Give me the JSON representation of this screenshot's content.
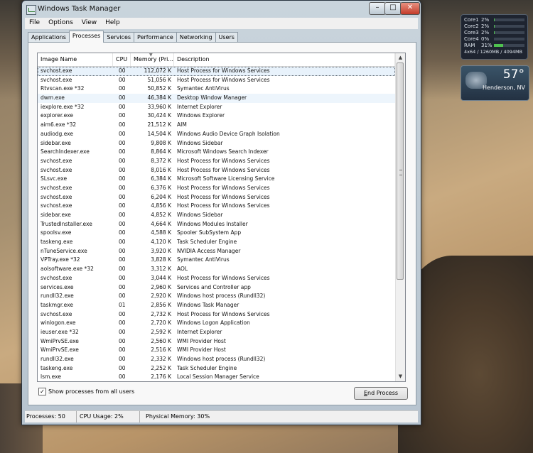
{
  "window": {
    "title": "Windows Task Manager"
  },
  "menu": [
    "File",
    "Options",
    "View",
    "Help"
  ],
  "tabs": [
    "Applications",
    "Processes",
    "Services",
    "Performance",
    "Networking",
    "Users"
  ],
  "active_tab": "Processes",
  "columns": {
    "name": "Image Name",
    "cpu": "CPU",
    "mem": "Memory (Pri...",
    "desc": "Description"
  },
  "processes": [
    [
      "svchost.exe",
      "00",
      "112,072 K",
      "Host Process for Windows Services"
    ],
    [
      "svchost.exe",
      "00",
      "51,056 K",
      "Host Process for Windows Services"
    ],
    [
      "Rtvscan.exe *32",
      "00",
      "50,852 K",
      "Symantec AntiVirus"
    ],
    [
      "dwm.exe",
      "00",
      "46,384 K",
      "Desktop Window Manager"
    ],
    [
      "iexplore.exe *32",
      "00",
      "33,960 K",
      "Internet Explorer"
    ],
    [
      "explorer.exe",
      "00",
      "30,424 K",
      "Windows Explorer"
    ],
    [
      "aim6.exe *32",
      "00",
      "21,512 K",
      "AIM"
    ],
    [
      "audiodg.exe",
      "00",
      "14,504 K",
      "Windows Audio Device Graph Isolation"
    ],
    [
      "sidebar.exe",
      "00",
      "9,808 K",
      "Windows Sidebar"
    ],
    [
      "SearchIndexer.exe",
      "00",
      "8,864 K",
      "Microsoft Windows Search Indexer"
    ],
    [
      "svchost.exe",
      "00",
      "8,372 K",
      "Host Process for Windows Services"
    ],
    [
      "svchost.exe",
      "00",
      "8,016 K",
      "Host Process for Windows Services"
    ],
    [
      "SLsvc.exe",
      "00",
      "6,384 K",
      "Microsoft Software Licensing Service"
    ],
    [
      "svchost.exe",
      "00",
      "6,376 K",
      "Host Process for Windows Services"
    ],
    [
      "svchost.exe",
      "00",
      "6,204 K",
      "Host Process for Windows Services"
    ],
    [
      "svchost.exe",
      "00",
      "4,856 K",
      "Host Process for Windows Services"
    ],
    [
      "sidebar.exe",
      "00",
      "4,852 K",
      "Windows Sidebar"
    ],
    [
      "TrustedInstaller.exe",
      "00",
      "4,664 K",
      "Windows Modules Installer"
    ],
    [
      "spoolsv.exe",
      "00",
      "4,588 K",
      "Spooler SubSystem App"
    ],
    [
      "taskeng.exe",
      "00",
      "4,120 K",
      "Task Scheduler Engine"
    ],
    [
      "nTuneService.exe",
      "00",
      "3,920 K",
      "NVIDIA Access Manager"
    ],
    [
      "VPTray.exe *32",
      "00",
      "3,828 K",
      "Symantec AntiVirus"
    ],
    [
      "aolsoftware.exe *32",
      "00",
      "3,312 K",
      "AOL"
    ],
    [
      "svchost.exe",
      "00",
      "3,044 K",
      "Host Process for Windows Services"
    ],
    [
      "services.exe",
      "00",
      "2,960 K",
      "Services and Controller app"
    ],
    [
      "rundll32.exe",
      "00",
      "2,920 K",
      "Windows host process (Rundll32)"
    ],
    [
      "taskmgr.exe",
      "01",
      "2,856 K",
      "Windows Task Manager"
    ],
    [
      "svchost.exe",
      "00",
      "2,732 K",
      "Host Process for Windows Services"
    ],
    [
      "winlogon.exe",
      "00",
      "2,720 K",
      "Windows Logon Application"
    ],
    [
      "ieuser.exe *32",
      "00",
      "2,592 K",
      "Internet Explorer"
    ],
    [
      "WmiPrvSE.exe",
      "00",
      "2,560 K",
      "WMI Provider Host"
    ],
    [
      "WmiPrvSE.exe",
      "00",
      "2,516 K",
      "WMI Provider Host"
    ],
    [
      "rundll32.exe",
      "00",
      "2,332 K",
      "Windows host process (Rundll32)"
    ],
    [
      "taskeng.exe",
      "00",
      "2,252 K",
      "Task Scheduler Engine"
    ],
    [
      "lsm.exe",
      "00",
      "2,176 K",
      "Local Session Manager Service"
    ]
  ],
  "show_all": {
    "label": "Show processes from all users",
    "checked": true
  },
  "end_button": {
    "prefix": "",
    "accel": "E",
    "rest": "nd Process"
  },
  "status": {
    "processes": "Processes: 50",
    "cpu": "CPU Usage: 2%",
    "memory": "Physical Memory: 30%"
  },
  "cpu_gadget": {
    "rows": [
      {
        "label": "Core1",
        "pct": "2%",
        "level": 0.02
      },
      {
        "label": "Core2",
        "pct": "2%",
        "level": 0.02
      },
      {
        "label": "Core3",
        "pct": "2%",
        "level": 0.02
      },
      {
        "label": "Core4",
        "pct": "0%",
        "level": 0.0
      },
      {
        "label": "RAM",
        "pct": "31%",
        "level": 0.31
      }
    ],
    "footer": "4x64 / 1260MB / 4094MB",
    "bar_color": "#4fc24f"
  },
  "weather": {
    "temp": "57°",
    "city": "Henderson, NV"
  }
}
